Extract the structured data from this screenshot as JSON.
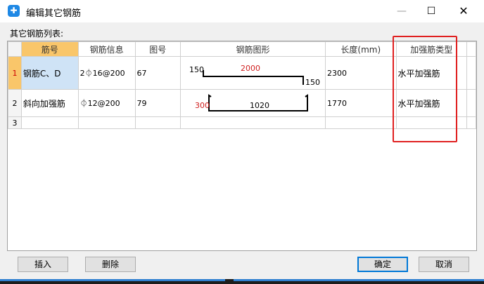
{
  "window": {
    "title": "编辑其它钢筋",
    "app_icon": "glodon-app-icon"
  },
  "controls": {
    "minimize": "—",
    "maximize": "☐",
    "close": "✕"
  },
  "list_label": "其它钢筋列表:",
  "table": {
    "columns": [
      "筋号",
      "钢筋信息",
      "图号",
      "钢筋图形",
      "长度(mm)",
      "加强筋类型"
    ],
    "rows": [
      {
        "index": "1",
        "name": "钢筋C、D",
        "info": "2⏀16@200",
        "fig": "67",
        "shape": {
          "left": "150",
          "top": "2000",
          "right": "150"
        },
        "length": "2300",
        "type": "水平加强筋"
      },
      {
        "index": "2",
        "name": "斜向加强筋",
        "info": "⏀12@200",
        "fig": "79",
        "shape": {
          "left": "300",
          "middle": "1020"
        },
        "length": "1770",
        "type": "水平加强筋"
      },
      {
        "index": "3",
        "name": "",
        "info": "",
        "fig": "",
        "length": "",
        "type": ""
      }
    ]
  },
  "buttons": {
    "insert": "插入",
    "delete": "删除",
    "ok": "确定",
    "cancel": "取消"
  },
  "colors": {
    "highlight_header": "#f9c66a",
    "selected_cell": "#cfe3f6",
    "annotation": "#e02020",
    "dim_red": "#d02020"
  }
}
